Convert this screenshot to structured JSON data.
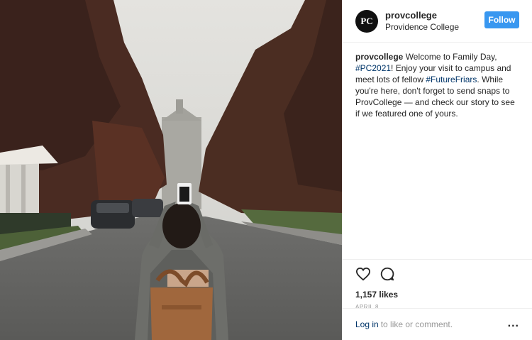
{
  "header": {
    "avatar_text": "PC",
    "username": "provcollege",
    "location": "Providence College",
    "follow_label": "Follow"
  },
  "caption": {
    "username": "provcollege",
    "part1": " Welcome to Family Day, ",
    "tag1": "#PC2021",
    "part2": "! Enjoy your visit to campus and meet lots of fellow ",
    "tag2": "#FutureFriars",
    "part3": ". While you're here, don't forget to send snaps to ProvCollege — and check our story to see if we featured one of yours."
  },
  "actions": {
    "like_icon": "heart-icon",
    "comment_icon": "comment-icon",
    "likes": "1,157 likes",
    "date": "April 8"
  },
  "comment_bar": {
    "login": "Log in",
    "rest": "to like or comment.",
    "more": "..."
  },
  "colors": {
    "follow_bg": "#3897f0",
    "link": "#003569"
  }
}
